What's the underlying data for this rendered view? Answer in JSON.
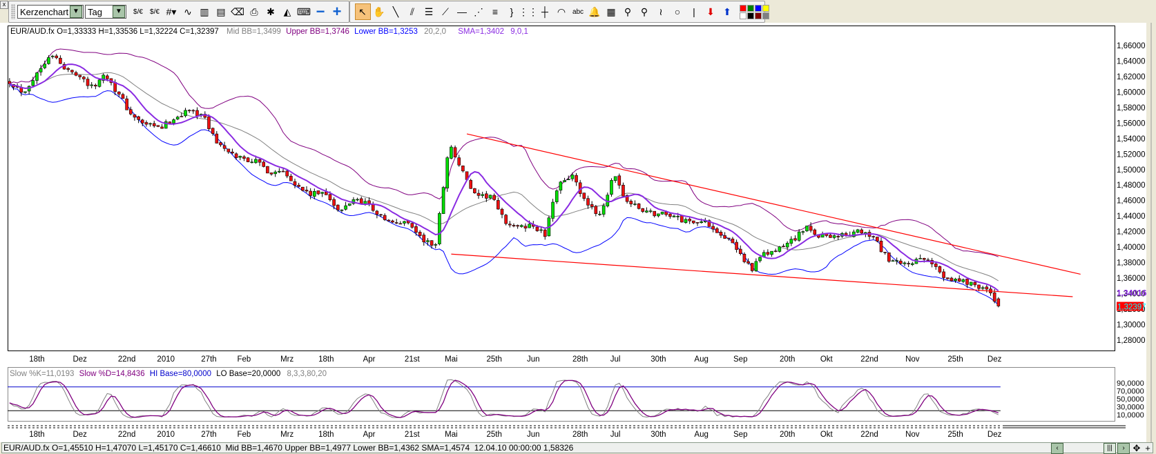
{
  "toolbar": {
    "close_label": "x",
    "chart_type": "Kerzenchart",
    "period": "Tag",
    "icons_left": [
      {
        "name": "currency-usd-eur-icon",
        "glyph": "$/€"
      },
      {
        "name": "currency-usd-eur-2-icon",
        "glyph": "$/€"
      },
      {
        "name": "grid-icon",
        "glyph": "#▾"
      },
      {
        "name": "indicator-wave-icon",
        "glyph": "∿"
      },
      {
        "name": "chart-window-icon",
        "glyph": "▥"
      },
      {
        "name": "chart-template-icon",
        "glyph": "▤"
      },
      {
        "name": "eraser-icon",
        "glyph": "⌫"
      },
      {
        "name": "printer-icon",
        "glyph": "⎙"
      },
      {
        "name": "expert-icon",
        "glyph": "✱"
      },
      {
        "name": "alert-indicator-icon",
        "glyph": "◭"
      },
      {
        "name": "keyboard-icon",
        "glyph": "⌨"
      },
      {
        "name": "zoom-out-minus-icon",
        "glyph": "−"
      },
      {
        "name": "zoom-in-plus-icon",
        "glyph": "+"
      }
    ],
    "icons_right": [
      {
        "name": "cursor-arrow-icon",
        "glyph": "↖",
        "active": true
      },
      {
        "name": "hand-pan-icon",
        "glyph": "✋"
      },
      {
        "name": "trend-line-icon",
        "glyph": "╲"
      },
      {
        "name": "channel-line-icon",
        "glyph": "⫽"
      },
      {
        "name": "horizontal-grid-icon",
        "glyph": "☰"
      },
      {
        "name": "gann-fan-icon",
        "glyph": "⟋"
      },
      {
        "name": "horizontal-line-icon",
        "glyph": "—"
      },
      {
        "name": "speed-fan-icon",
        "glyph": "⋰"
      },
      {
        "name": "fibonacci-icon",
        "glyph": "≡"
      },
      {
        "name": "fibonacci-bracket-icon",
        "glyph": "}"
      },
      {
        "name": "vertical-grid-icon",
        "glyph": "⋮⋮"
      },
      {
        "name": "crosshair-icon",
        "glyph": "┼"
      },
      {
        "name": "arc-icon",
        "glyph": "◠"
      },
      {
        "name": "text-abc-icon",
        "glyph": "abc"
      },
      {
        "name": "alarm-bell-icon",
        "glyph": "🔔"
      },
      {
        "name": "calculator-icon",
        "glyph": "▦"
      },
      {
        "name": "magnifier-icon",
        "glyph": "⚲"
      },
      {
        "name": "magnifier-box-icon",
        "glyph": "⚲"
      },
      {
        "name": "freehand-curve-icon",
        "glyph": "≀"
      },
      {
        "name": "circle-icon",
        "glyph": "○"
      },
      {
        "name": "vertical-line-icon",
        "glyph": "|"
      },
      {
        "name": "sell-arrow-down-icon",
        "glyph": "⬇",
        "color": "#e00000"
      },
      {
        "name": "buy-arrow-up-icon",
        "glyph": "⬆",
        "color": "#0033cc"
      }
    ],
    "palette": [
      "#ff0000",
      "#008000",
      "#0000ff",
      "#ffff00",
      "#ffffff",
      "#000000",
      "#800000",
      "#808080"
    ]
  },
  "main_header": {
    "ohlc": "EUR/AUD.fx O=1,33333 H=1,33536 L=1,32224 C=1,32397",
    "mid_bb": "Mid BB=1,3499",
    "upper_bb": "Upper BB=1,3746",
    "lower_bb": "Lower BB=1,3253",
    "bb_params": "20,2,0",
    "sma": "SMA=1,3402",
    "sma_params": "9,0,1"
  },
  "stoch_header": {
    "slow_k": "Slow %K=11,0193",
    "slow_d": "Slow %D=14,8436",
    "hi_base": "HI Base=80,0000",
    "lo_base": "LO Base=20,0000",
    "params": "8,3,3,80,20"
  },
  "price_markers": {
    "sma_value": "1,34016",
    "last_close": "1,32397"
  },
  "colors": {
    "up": "#00dd00",
    "down": "#ee1111",
    "upper_bb": "#800080",
    "lower_bb": "#0000ff",
    "mid_bb": "#808080",
    "sma": "#8a2be2",
    "trendline": "#ff0000",
    "stoch_k": "#808080",
    "stoch_d": "#800080",
    "hi_base": "#0000cc",
    "lo_base": "#000000"
  },
  "chart_data": {
    "type": "candlestick",
    "symbol": "EUR/AUD.fx",
    "candle_count": 254,
    "close_anchors": [
      1.614,
      1.6,
      1.624,
      1.652,
      1.629,
      1.624,
      1.605,
      1.624,
      1.595,
      1.567,
      1.557,
      1.553,
      1.567,
      1.576,
      1.572,
      1.538,
      1.519,
      1.515,
      1.51,
      1.496,
      1.5,
      1.477,
      1.467,
      1.472,
      1.443,
      1.462,
      1.458,
      1.439,
      1.429,
      1.434,
      1.41,
      1.401,
      1.534,
      1.496,
      1.462,
      1.467,
      1.434,
      1.424,
      1.429,
      1.415,
      1.486,
      1.491,
      1.453,
      1.443,
      1.491,
      1.458,
      1.448,
      1.443,
      1.443,
      1.434,
      1.434,
      1.429,
      1.415,
      1.396,
      1.372,
      1.391,
      1.396,
      1.41,
      1.424,
      1.415,
      1.415,
      1.415,
      1.42,
      1.41,
      1.382,
      1.377,
      1.382,
      1.382,
      1.363,
      1.358,
      1.353,
      1.348,
      1.324
    ],
    "y_axis": {
      "min": 1.27,
      "max": 1.67,
      "ticks": [
        "1,66000",
        "1,64000",
        "1,62000",
        "1,60000",
        "1,58000",
        "1,56000",
        "1,54000",
        "1,52000",
        "1,50000",
        "1,48000",
        "1,46000",
        "1,44000",
        "1,42000",
        "1,40000",
        "1,38000",
        "1,36000",
        "1,34000",
        "1,32000",
        "1,30000",
        "1,28000"
      ]
    },
    "x_axis_labels": [
      {
        "label": "18th",
        "index": 7
      },
      {
        "label": "Dez",
        "index": 18
      },
      {
        "label": "22nd",
        "index": 30
      },
      {
        "label": "2010",
        "index": 40
      },
      {
        "label": "27th",
        "index": 51
      },
      {
        "label": "Feb",
        "index": 60
      },
      {
        "label": "Mrz",
        "index": 71
      },
      {
        "label": "18th",
        "index": 81
      },
      {
        "label": "Apr",
        "index": 92
      },
      {
        "label": "21st",
        "index": 103
      },
      {
        "label": "Mai",
        "index": 113
      },
      {
        "label": "25th",
        "index": 124
      },
      {
        "label": "Jun",
        "index": 134
      },
      {
        "label": "28th",
        "index": 146
      },
      {
        "label": "Jul",
        "index": 155
      },
      {
        "label": "30th",
        "index": 166
      },
      {
        "label": "Aug",
        "index": 177
      },
      {
        "label": "Sep",
        "index": 187
      },
      {
        "label": "20th",
        "index": 199
      },
      {
        "label": "Okt",
        "index": 209
      },
      {
        "label": "22nd",
        "index": 220
      },
      {
        "label": "Nov",
        "index": 231
      },
      {
        "label": "25th",
        "index": 242
      },
      {
        "label": "Dez",
        "index": 252
      }
    ],
    "indicators": {
      "bollinger": {
        "period": 20,
        "dev": 2
      },
      "sma": {
        "period": 9
      },
      "stochastic": {
        "k": 8,
        "slow": 3,
        "d": 3,
        "hi": 80,
        "lo": 20
      }
    },
    "trendlines": [
      {
        "name": "upper",
        "from": {
          "index": 117,
          "price": 1.546
        },
        "to": {
          "index": 274,
          "price": 1.365
        }
      },
      {
        "name": "lower",
        "from": {
          "index": 113,
          "price": 1.391
        },
        "to": {
          "index": 272,
          "price": 1.336
        }
      }
    ],
    "stoch_axis": {
      "ticks": [
        "90,0000",
        "70,0000",
        "50,0000",
        "30,0000",
        "10,0000"
      ]
    }
  },
  "status_bar": {
    "text": "EUR/AUD.fx O=1,45510 H=1,47070 L=1,45170 C=1,46610  Mid BB=1,4670 Upper BB=1,4977 Lower BB=1,4362 SMA=1,4574  12.04.10 00:00:00 1,58326",
    "nav": [
      {
        "name": "scroll-left-button",
        "glyph": "‹",
        "btn": true
      },
      {
        "name": "scroll-thumb",
        "glyph": "|||",
        "btn": true
      },
      {
        "name": "scroll-right-button",
        "glyph": "›",
        "btn": true
      },
      {
        "name": "move-cross-icon",
        "glyph": "✥",
        "btn": false
      },
      {
        "name": "zoom-plus-icon",
        "glyph": "+",
        "btn": false
      },
      {
        "name": "zoom-minus-icon",
        "glyph": "−",
        "btn": false
      },
      {
        "name": "reset-undo-icon",
        "glyph": "↶",
        "btn": false
      }
    ]
  }
}
